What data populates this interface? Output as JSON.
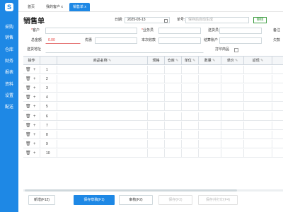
{
  "sidebar": {
    "logo": "S",
    "items": [
      {
        "label": "采购"
      },
      {
        "label": "销售"
      },
      {
        "label": "仓库"
      },
      {
        "label": "财务"
      },
      {
        "label": "报表"
      },
      {
        "label": "资料"
      },
      {
        "label": "设置"
      },
      {
        "label": "配送"
      }
    ]
  },
  "tabs": [
    {
      "label": "首页"
    },
    {
      "label": "我的客户 x"
    },
    {
      "label": "销售单 x"
    }
  ],
  "page_title": "销售单",
  "form": {
    "date_label": "日期:",
    "date_value": "2025-05-13",
    "doc_no_label": "单号:",
    "doc_no_placeholder": "保存后自动生成",
    "confirm_label": "审核",
    "customer_label": "客户",
    "salesperson_label": "业务员",
    "delivery_person_label": "送货员",
    "remark_label": "备注",
    "total_label": "总金额",
    "total_value": "0.00",
    "discount_label": "优惠",
    "received_label": "本次收款",
    "settle_account_label": "结算账户",
    "owed_label": "欠款",
    "address_label": "送货地址",
    "print_label": "打印商品"
  },
  "table": {
    "headers": {
      "op": "操作",
      "product": "商品名称",
      "spec": "规格",
      "warehouse": "仓库",
      "unit": "单位",
      "qty": "数量",
      "price": "单价",
      "return": "返现"
    },
    "rows": [
      "1",
      "2",
      "3",
      "4",
      "5",
      "6",
      "7",
      "8",
      "9",
      "10"
    ]
  },
  "footer": {
    "new_label": "新增(F12)",
    "save_draft_label": "保存草稿(F1)",
    "audit_label": "审核(F2)",
    "btn4_label": "保存(F3)",
    "btn5_label": "保存并打印(F4)"
  },
  "colors": {
    "primary": "#1e88e5",
    "confirm": "#43a047",
    "required": "#e53935"
  }
}
